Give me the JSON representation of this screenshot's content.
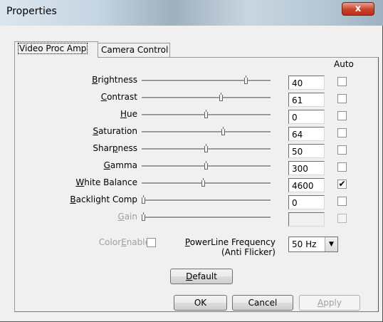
{
  "window": {
    "title": "Properties",
    "close_label": "x"
  },
  "tabs": [
    {
      "label": "Video Proc Amp",
      "active": true
    },
    {
      "label": "Camera Control",
      "active": false
    }
  ],
  "auto_header": "Auto",
  "controls": [
    {
      "key": "B",
      "rest": "rightness",
      "pre": "",
      "value": "40",
      "auto": false,
      "slider": 0.82,
      "enabled": true
    },
    {
      "key": "C",
      "rest": "ontrast",
      "pre": "",
      "value": "61",
      "auto": false,
      "slider": 0.62,
      "enabled": true
    },
    {
      "key": "H",
      "rest": "ue",
      "pre": "",
      "value": "0",
      "auto": false,
      "slider": 0.5,
      "enabled": true
    },
    {
      "key": "S",
      "rest": "aturation",
      "pre": "",
      "value": "64",
      "auto": false,
      "slider": 0.64,
      "enabled": true
    },
    {
      "key": "p",
      "rest": "ness",
      "pre": "Shar",
      "value": "50",
      "auto": false,
      "slider": 0.5,
      "enabled": true
    },
    {
      "key": "G",
      "rest": "amma",
      "pre": "",
      "value": "300",
      "auto": false,
      "slider": 0.5,
      "enabled": true
    },
    {
      "key": "W",
      "rest": "hite Balance",
      "pre": "",
      "value": "4600",
      "auto": true,
      "slider": 0.48,
      "enabled": true
    },
    {
      "key": "B",
      "rest": "acklight Comp",
      "pre": "",
      "value": "0",
      "auto": false,
      "slider": 0.0,
      "enabled": true
    },
    {
      "key": "G",
      "rest": "ain",
      "pre": "",
      "value": "",
      "auto": false,
      "slider": 0.0,
      "enabled": false
    }
  ],
  "color_enable": {
    "pre": "Color",
    "key": "E",
    "rest": "nable",
    "checked": false
  },
  "powerline": {
    "pre": "",
    "key": "P",
    "rest": "owerLine Frequency",
    "line2": "(Anti Flicker)",
    "selected": "50 Hz"
  },
  "buttons": {
    "default": {
      "key": "D",
      "rest": "efault"
    },
    "ok": "OK",
    "cancel": "Cancel",
    "apply_key": "A",
    "apply_rest": "pply"
  },
  "colors": {
    "window_bg": "#f0f0f0",
    "close_red": "#c8432a",
    "disabled_text": "#a0a0a0"
  }
}
